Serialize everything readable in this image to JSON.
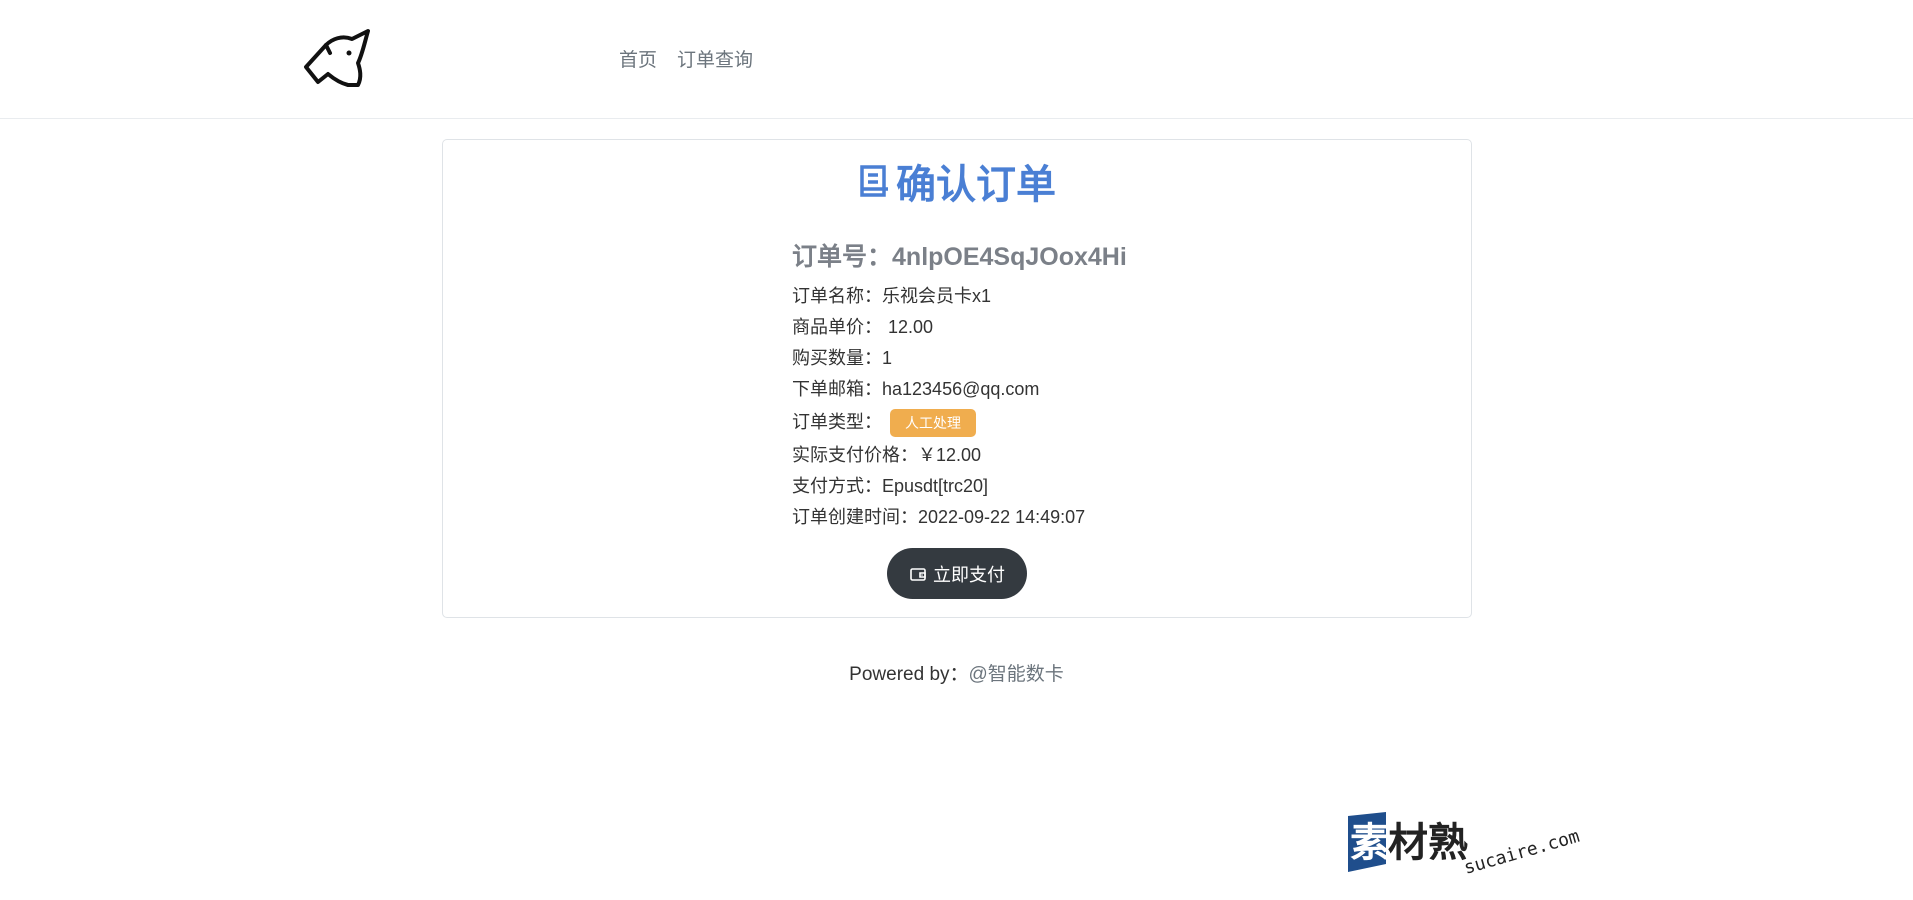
{
  "header": {
    "logo_icon": "unicorn-head-icon",
    "nav": [
      {
        "label": "首页"
      },
      {
        "label": "订单查询"
      }
    ]
  },
  "card": {
    "title_icon": "receipt-icon",
    "title": "确认订单",
    "order_no_label": "订单号：",
    "order_no": "4nlpOE4SqJOox4Hi",
    "fields": [
      {
        "key": "订单名称：",
        "value": "乐视会员卡x1"
      },
      {
        "key": "商品单价：",
        "value": " 12.00"
      },
      {
        "key": "购买数量：",
        "value": "1"
      },
      {
        "key": "下单邮箱：",
        "value": "ha123456@qq.com"
      }
    ],
    "order_type_label": "订单类型：",
    "order_type_badge": "人工处理",
    "fields2": [
      {
        "key": "实际支付价格：",
        "value": "￥12.00"
      },
      {
        "key": "支付方式：",
        "value": "Epusdt[trc20]"
      },
      {
        "key": "订单创建时间：",
        "value": "2022-09-22 14:49:07"
      }
    ],
    "pay_button_icon": "wallet-icon",
    "pay_button": "立即支付"
  },
  "footer": {
    "prefix": "Powered by：",
    "link": "@智能数卡"
  },
  "watermark": {
    "brand": "素材熟",
    "domain": "sucaire.com"
  },
  "colors": {
    "title": "#4a7fd4",
    "badge": "#f0ad4e",
    "button": "#343a40"
  }
}
